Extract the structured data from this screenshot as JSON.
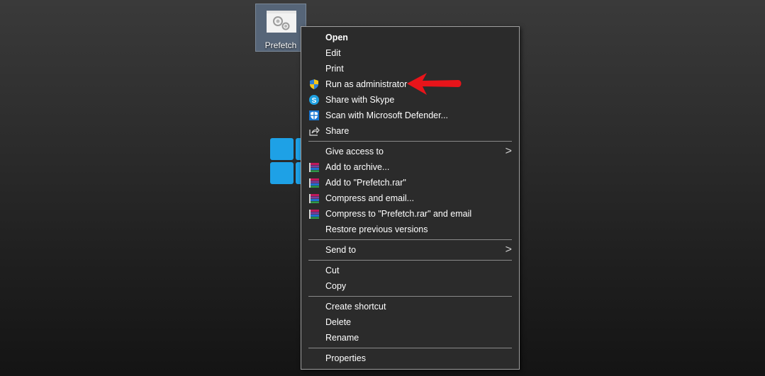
{
  "desktop": {
    "folder_label": "Prefetch"
  },
  "menu": {
    "items": [
      {
        "label": "Open",
        "bold": true
      },
      {
        "label": "Edit"
      },
      {
        "label": "Print"
      },
      {
        "label": "Run as administrator",
        "icon": "uac-shield-icon"
      },
      {
        "label": "Share with Skype",
        "icon": "skype-icon"
      },
      {
        "label": "Scan with Microsoft Defender...",
        "icon": "defender-shield-icon"
      },
      {
        "label": "Share",
        "icon": "share-icon"
      },
      {
        "label": "Give access to",
        "submenu": true
      },
      {
        "label": "Add to archive...",
        "icon": "winrar-icon"
      },
      {
        "label": "Add to \"Prefetch.rar\"",
        "icon": "winrar-icon"
      },
      {
        "label": "Compress and email...",
        "icon": "winrar-icon"
      },
      {
        "label": "Compress to \"Prefetch.rar\" and email",
        "icon": "winrar-icon"
      },
      {
        "label": "Restore previous versions"
      },
      {
        "label": "Send to",
        "submenu": true
      },
      {
        "label": "Cut"
      },
      {
        "label": "Copy"
      },
      {
        "label": "Create shortcut"
      },
      {
        "label": "Delete"
      },
      {
        "label": "Rename"
      },
      {
        "label": "Properties"
      }
    ],
    "submenu_glyph": ">"
  },
  "annotation": {
    "arrow_color": "#e8141a",
    "points_to": "Run as administrator"
  },
  "colors": {
    "menu_bg": "#2b2b2b",
    "menu_border": "#a0a0a0",
    "selection_bg": "#566578",
    "windows_blue": "#1ea1e6"
  }
}
